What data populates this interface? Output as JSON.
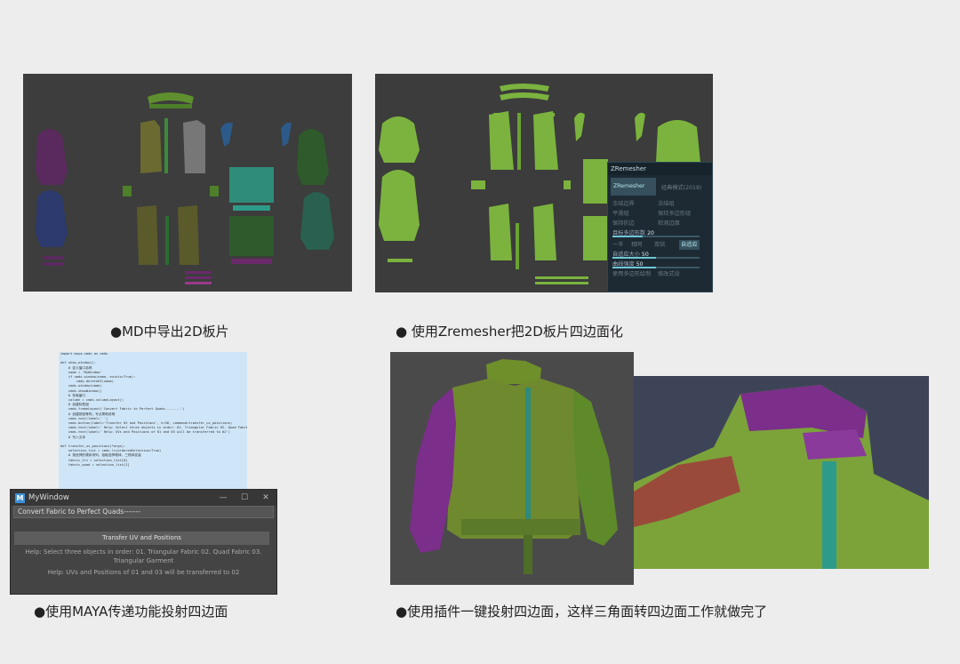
{
  "captions": {
    "c1": "●MD中导出2D板片",
    "c2": "● 使用Zremesher把2D板片四边面化",
    "c3": "●使用MAYA传递功能投射四边面",
    "c4": "●使用插件一键投射四边面，这样三角面转四边面工作就做完了"
  },
  "code_lines": [
    "import maya.cmds as cmds",
    "",
    "def show_window():",
    "    # 定义窗口名称",
    "    name = 'MyWindow'",
    "    if cmds.window(name, exists=True):",
    "        cmds.deleteUI(name)",
    "    cmds.window(name)",
    "    cmds.showWindow()",
    "    # 布局窗口",
    "    column = cmds.columnLayout()",
    "    # 创建标签组",
    "    cmds.frameLayout('Convert Fabric to Perfect Quads--------')",
    "    # 创建按钮等同，写点帮助说明",
    "    cmds.text(label=' ')",
    "    cmds.button(label='Transfer UV and Positions', h=30, command=transfer_uv_positions)",
    "    cmds.text(label=' Help: Select three objects in order: 01. Triangular Fabric 02. Quad Fabric 03. Triangular Garment')",
    "    cmds.text(label=' Help: UVs and Positions of 01 and 03 will be transferred to 02')",
    "    # 写入文本",
    "",
    "def transfer_uv_positions(*args):",
    "    selection_list = cmds.ls(orderedSelection=True)",
    "    # 按选择的顺序排列，拾取选择物体，三物体变量",
    "    fabric_tri = selection_list[0]",
    "    fabric_quad = selection_list[1]"
  ],
  "maya_window": {
    "title": "MyWindow",
    "app_icon": "M",
    "minimize_icon": "—",
    "maximize_icon": "☐",
    "close_icon": "✕",
    "frame_label": "Convert Fabric to Perfect Quads-------",
    "button_label": "Transfer UV and Positions",
    "help1": "Help: Select three objects in order: 01. Triangular Fabric 02. Quad Fabric 03. Triangular Garment",
    "help2": "Help: UVs and Positions of 01 and 03 will be transferred to 02"
  },
  "zremesher": {
    "title": "ZRemesher",
    "tab_active": "ZRemesher",
    "tab_legacy": "经典模式(2018)",
    "opt_freeze_borders": "冻结边界",
    "opt_freeze_groups": "冻结组",
    "opt_smooth_groups": "平滑组",
    "opt_keep_creases": "保持折边",
    "opt_keep_groups": "保持多边形组",
    "opt_detect_edges": "检测边缘",
    "target_label": "目标多边形数",
    "target_value": "20",
    "btn_half": "一半",
    "btn_same": "相同",
    "btn_double": "双倍",
    "btn_adapt": "自适应",
    "adaptive_label": "自适应大小",
    "adaptive_value": "50",
    "curve_label": "曲线强度",
    "curve_value": "50",
    "bottom_label": "使用多边形绘制",
    "bottom_label2": "修改式设"
  },
  "colors": {
    "green": "#7bb33e",
    "purple": "#7b2e8a",
    "teal": "#2e9b8a",
    "panel_bg": "#3b3c3b"
  }
}
